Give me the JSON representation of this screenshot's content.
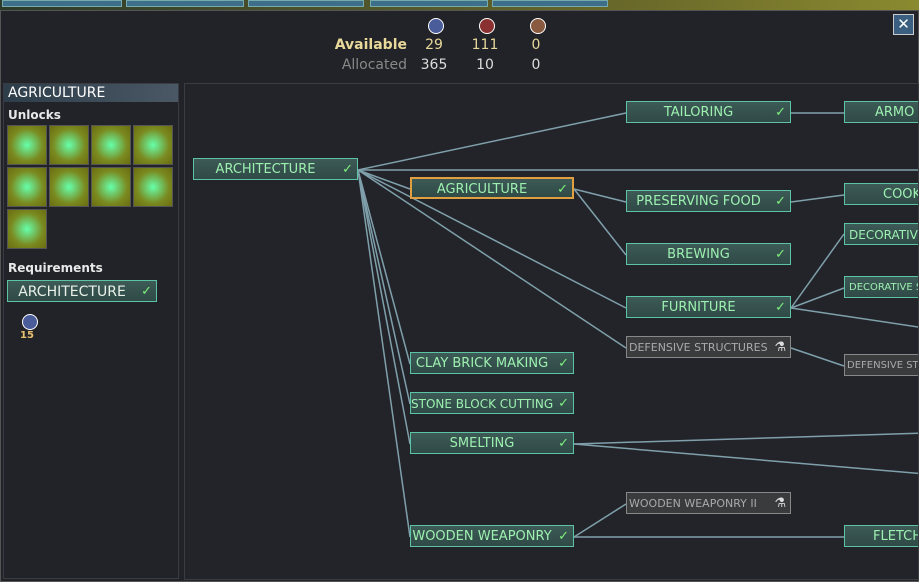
{
  "resources": {
    "available_label": "Available",
    "allocated_label": "Allocated",
    "columns": [
      {
        "icon": "blue-knowledge-icon",
        "available": "29",
        "allocated": "365"
      },
      {
        "icon": "red-knowledge-icon",
        "available": "111",
        "allocated": "10"
      },
      {
        "icon": "brown-knowledge-icon",
        "available": "0",
        "allocated": "0"
      }
    ]
  },
  "close_label": "✕",
  "detail": {
    "title": "AGRICULTURE",
    "unlocks_label": "Unlocks",
    "requirements_label": "Requirements",
    "requirement": "ARCHITECTURE",
    "cost": "15",
    "cost_icon": "blue-knowledge-icon"
  },
  "nodes": {
    "architecture": "ARCHITECTURE",
    "agriculture": "AGRICULTURE",
    "tailoring": "TAILORING",
    "armo": "ARMO",
    "preserving": "PRESERVING FOOD",
    "cook": "COOK",
    "brewing": "BREWING",
    "decorativ": "DECORATIVE",
    "decorative_s": "DECORATIVE S",
    "furniture": "FURNITURE",
    "defensive": "DEFENSIVE STRUCTURES",
    "defensive_st": "DEFENSIVE ST",
    "clay": "CLAY BRICK MAKING",
    "stone": "STONE BLOCK CUTTING",
    "smelting": "SMELTING",
    "ww2": "WOODEN WEAPONRY II",
    "ww": "WOODEN WEAPONRY",
    "fletch": "FLETCH"
  },
  "icons": {
    "researched": "flask-check-icon",
    "unresearched": "flask-icon"
  },
  "colors": {
    "accent": "#5cc4a4",
    "selected": "#e0a040",
    "available_text": "#e8d89a",
    "line": "#7fa0ab"
  }
}
